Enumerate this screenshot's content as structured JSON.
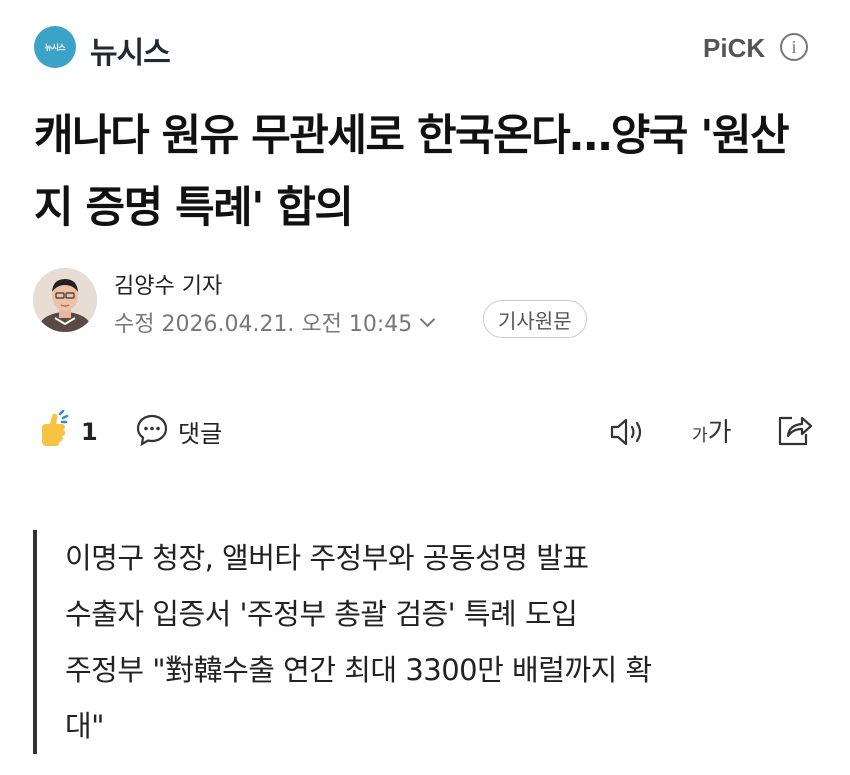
{
  "header": {
    "logo_text": "뉴시스",
    "press_name": "뉴시스",
    "pick_label": "PiCK",
    "info_glyph": "i"
  },
  "article": {
    "title": "캐나다 원유 무관세로 한국온다…양국 '원산지 증명 특례' 합의"
  },
  "reporter": {
    "name": "김양수 기자",
    "date": "수정 2026.04.21. 오전 10:45",
    "original_button": "기사원문"
  },
  "actions": {
    "like_count": "1",
    "comment_label": "댓글",
    "font_small": "가",
    "font_large": "가"
  },
  "summary": [
    "이명구 청장, 앨버타 주정부와 공동성명 발표",
    "수출자 입증서 '주정부 총괄 검증' 특례 도입",
    "주정부 \"對韓수출 연간 최대 3300만 배럴까지 확",
    "대\""
  ],
  "colors": {
    "logo_bg": "#3aa3c7",
    "like_yellow": "#f6c343",
    "like_blue": "#3b86d6"
  }
}
